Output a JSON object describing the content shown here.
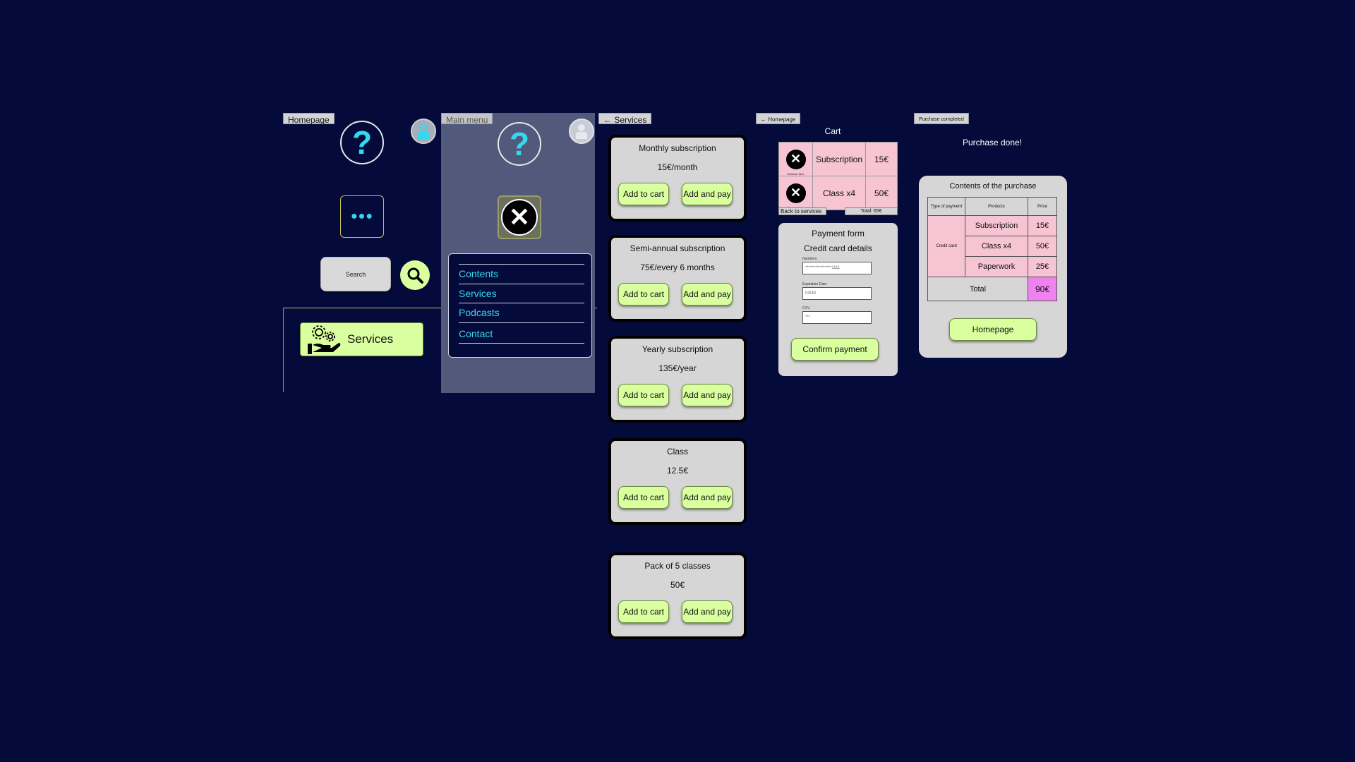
{
  "homepage": {
    "label": "Homepage",
    "help_glyph": "?",
    "dots_glyph": "●●●",
    "search_placeholder": "Search",
    "services_label": "Services",
    "icons": [
      "help-icon",
      "user-icon",
      "more-dots-icon",
      "search-icon",
      "services-hand-gear-icon"
    ]
  },
  "main_menu": {
    "label": "Main menu",
    "help_glyph": "?",
    "close_glyph": "✕",
    "items": [
      "Contents",
      "Services",
      "Podcasts",
      "Contact"
    ]
  },
  "services": {
    "label": "← Services",
    "add_to_cart": "Add to cart",
    "add_and_pay": "Add and pay",
    "items": [
      {
        "title": "Monthly subscription",
        "price": "15€/month"
      },
      {
        "title": "Semi-annual subscription",
        "price": "75€/every 6 months"
      },
      {
        "title": "Yearly subscription",
        "price": "135€/year"
      },
      {
        "title": "Class",
        "price": "12.5€"
      },
      {
        "title": "Pack of 5 classes",
        "price": "50€"
      }
    ]
  },
  "cart": {
    "label": "← Homepage",
    "title": "Cart",
    "remove_label": "Remove item",
    "rows": [
      {
        "item": "Subscription",
        "price": "15€"
      },
      {
        "item": "Class x4",
        "price": "50€"
      }
    ],
    "back_label": "Back to services",
    "total_label": "Total: 65€",
    "payment": {
      "title": "Payment form",
      "subtitle": "Credit card details",
      "numbers_label": "Numbers",
      "numbers_value": "****************1111",
      "expiration_label": "Expiration Date",
      "expiration_value": "03/30",
      "cvv_label": "CVV",
      "cvv_value": "***",
      "confirm": "Confirm payment"
    }
  },
  "purchase": {
    "label": "Purchase completed",
    "done": "Purchase done!",
    "contents_title": "Contents of the purchase",
    "headers": [
      "Type of payment",
      "Products",
      "Price"
    ],
    "payment_type": "Credit card",
    "rows": [
      {
        "product": "Subscription",
        "price": "15€"
      },
      {
        "product": "Class x4",
        "price": "50€"
      },
      {
        "product": "Paperwork",
        "price": "25€"
      }
    ],
    "total_label": "Total",
    "total_value": "90€",
    "homepage_button": "Homepage"
  },
  "colors": {
    "background": "#040b3a",
    "accent_green": "#d9ff9f",
    "accent_cyan": "#35d8ee",
    "cart_pink": "#f7c4d4",
    "total_magenta": "#ee82ee",
    "menu_panel": "#525a7c"
  }
}
